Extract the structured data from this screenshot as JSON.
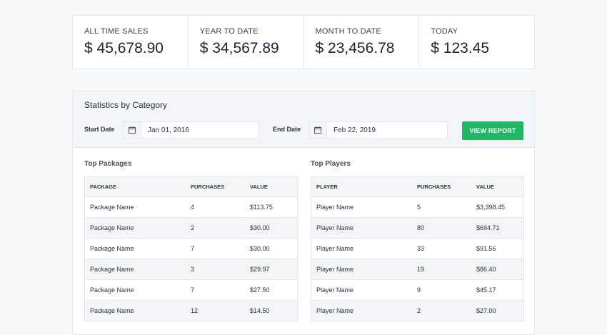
{
  "stats": [
    {
      "label": "ALL TIME SALES",
      "value": "$ 45,678.90"
    },
    {
      "label": "YEAR TO DATE",
      "value": "$ 34,567.89"
    },
    {
      "label": "MONTH TO DATE",
      "value": "$ 23,456.78"
    },
    {
      "label": "TODAY",
      "value": "$ 123.45"
    }
  ],
  "panel": {
    "title": "Statistics by Category",
    "start_label": "Start Date",
    "start_value": "Jan 01, 2016",
    "end_label": "End Date",
    "end_value": "Feb 22, 2019",
    "button_label": "VIEW REPORT",
    "icons": {
      "date": "calendar-icon"
    },
    "colors": {
      "button": "#22b564"
    }
  },
  "packages": {
    "title": "Top Packages",
    "headers": [
      "PACKAGE",
      "PURCHASES",
      "VALUE"
    ],
    "rows": [
      [
        "Package Name",
        "4",
        "$113.75"
      ],
      [
        "Package Name",
        "2",
        "$30.00"
      ],
      [
        "Package Name",
        "7",
        "$30.00"
      ],
      [
        "Package Name",
        "3",
        "$29.97"
      ],
      [
        "Package Name",
        "7",
        "$27.50"
      ],
      [
        "Package Name",
        "12",
        "$14.50"
      ]
    ]
  },
  "players": {
    "title": "Top Players",
    "headers": [
      "PLAYER",
      "PURCHASES",
      "VALUE"
    ],
    "rows": [
      [
        "Player Name",
        "5",
        "$3,398.45"
      ],
      [
        "Player Name",
        "80",
        "$694.71"
      ],
      [
        "Player Name",
        "33",
        "$91.56"
      ],
      [
        "Player Name",
        "19",
        "$86.40"
      ],
      [
        "Player Name",
        "9",
        "$45.17"
      ],
      [
        "Player Name",
        "2",
        "$27.00"
      ]
    ]
  }
}
